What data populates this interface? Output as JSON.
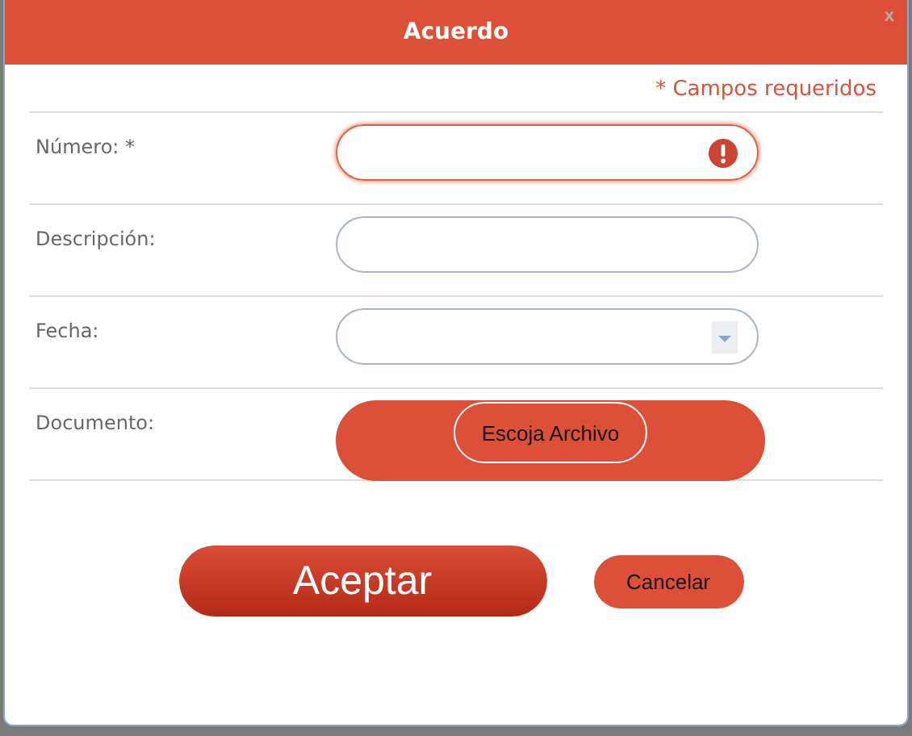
{
  "dialog": {
    "title": "Acuerdo",
    "close": "x"
  },
  "required_note": "* Campos requeridos",
  "fields": [
    {
      "kind": "text",
      "label": "Número: *",
      "error": true
    },
    {
      "kind": "text",
      "label": "Descripción:",
      "error": false
    },
    {
      "kind": "select",
      "label": "Fecha:",
      "error": false
    },
    {
      "kind": "file",
      "label": "Documento:",
      "button": "Escoja Archivo"
    }
  ],
  "buttons": {
    "primary": "Aceptar",
    "secondary": "Cancelar"
  }
}
